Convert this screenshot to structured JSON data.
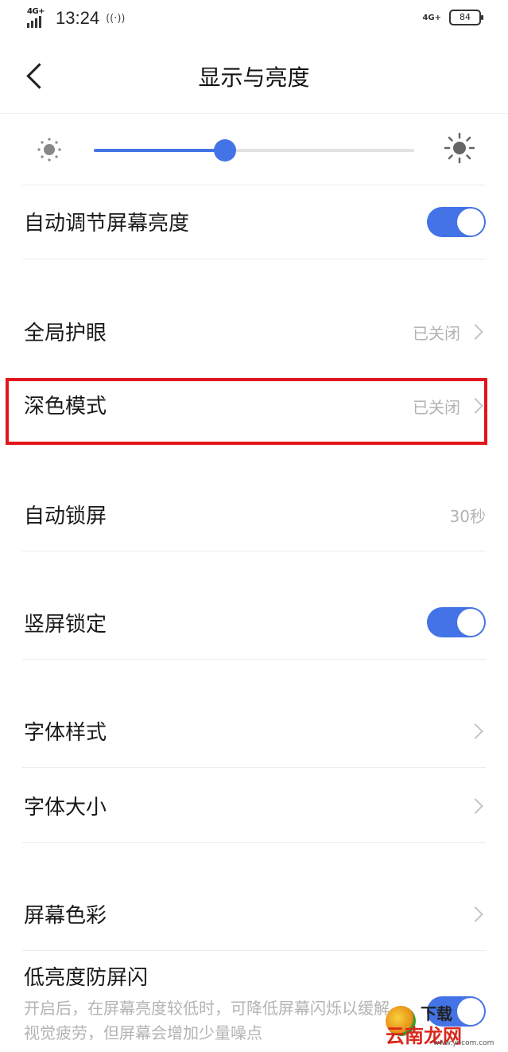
{
  "status_bar": {
    "network_left": "4G+",
    "time": "13:24",
    "vibrate_icon": "vibrate-icon",
    "network_right": "4G+",
    "battery": "84"
  },
  "header": {
    "back_icon": "chevron-left-icon",
    "title": "显示与亮度"
  },
  "brightness": {
    "low_icon": "sun-small-icon",
    "high_icon": "sun-large-icon",
    "level": 0.41
  },
  "settings": {
    "auto_brightness": {
      "label": "自动调节屏幕亮度",
      "enabled": true
    },
    "eye_care": {
      "label": "全局护眼",
      "value": "已关闭"
    },
    "dark_mode": {
      "label": "深色模式",
      "value": "已关闭"
    },
    "auto_lock": {
      "label": "自动锁屏",
      "value": "30秒"
    },
    "portrait_lock": {
      "label": "竖屏锁定",
      "enabled": true
    },
    "font_style": {
      "label": "字体样式"
    },
    "font_size": {
      "label": "字体大小"
    },
    "screen_color": {
      "label": "屏幕色彩"
    },
    "low_brightness_flicker": {
      "label": "低亮度防屏闪",
      "description": "开启后，在屏幕亮度较低时，可降低屏幕闪烁以缓解视觉疲劳，但屏幕会增加少量噪点",
      "enabled": true
    }
  },
  "colors": {
    "accent": "#4373e6",
    "highlight_border": "#e3141b"
  },
  "watermark": {
    "top": "下载",
    "main": "云南龙网",
    "url": "www.yncom.com"
  }
}
